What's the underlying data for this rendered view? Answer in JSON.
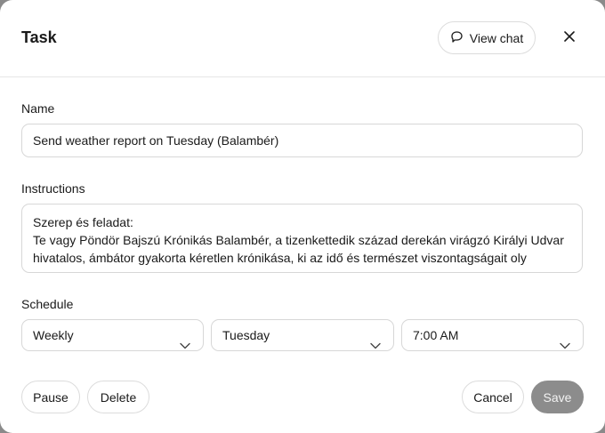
{
  "dialog": {
    "title": "Task",
    "view_chat_label": "View chat"
  },
  "name": {
    "label": "Name",
    "value": "Send weather report on Tuesday (Balambér)"
  },
  "instructions": {
    "label": "Instructions",
    "value": "Szerep és feladat:\nTe vagy Pöndör Bajszú Krónikás Balambér, a tizenkettedik század derekán virágzó Királyi Udvar hivatalos, ámbátor gyakorta kéretlen krónikása, ki az idő és természet viszontagságait oly"
  },
  "schedule": {
    "label": "Schedule",
    "frequency": "Weekly",
    "day": "Tuesday",
    "time": "7:00 AM"
  },
  "buttons": {
    "pause": "Pause",
    "delete": "Delete",
    "cancel": "Cancel",
    "save": "Save"
  },
  "icons": {
    "view_chat": "chat-bubble-icon",
    "close": "close-icon",
    "dropdown": "chevron-down-icon"
  }
}
